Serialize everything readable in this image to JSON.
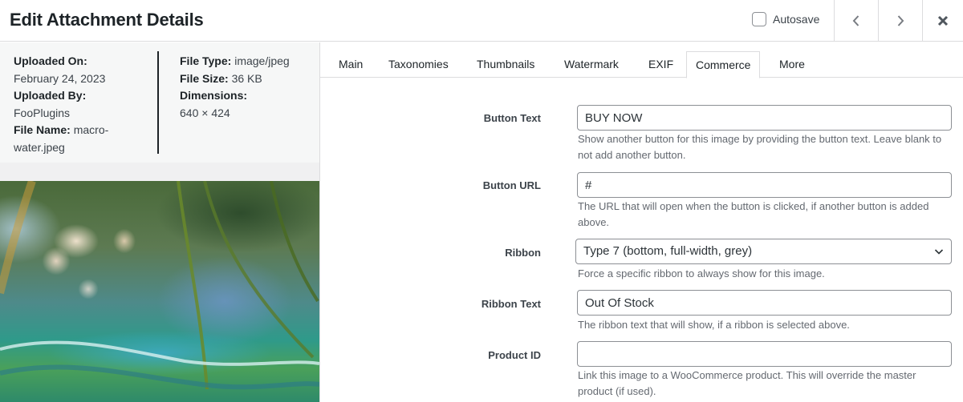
{
  "header": {
    "title": "Edit Attachment Details",
    "autosave_label": "Autosave",
    "autosave_checked": false,
    "icons": {
      "prev": "chevron-left-icon",
      "next": "chevron-right-icon",
      "close": "close-icon"
    }
  },
  "meta": {
    "uploaded_on_label": "Uploaded On:",
    "uploaded_on_value": "February 24, 2023",
    "uploaded_by_label": "Uploaded By:",
    "uploaded_by_value": "FooPlugins",
    "file_name_label": "File Name:",
    "file_name_value_1": "macro-",
    "file_name_value_2": "water.jpeg",
    "file_type_label": "File Type:",
    "file_type_value": "image/jpeg",
    "file_size_label": "File Size:",
    "file_size_value": "36 KB",
    "dimensions_label": "Dimensions:",
    "dimensions_value": "640 × 424"
  },
  "preview": {
    "alt": "macro water photo"
  },
  "tabs": [
    {
      "label": "Main",
      "active": false
    },
    {
      "label": "Taxonomies",
      "active": false
    },
    {
      "label": "Thumbnails",
      "active": false
    },
    {
      "label": "Watermark",
      "active": false
    },
    {
      "label": "EXIF",
      "active": false
    },
    {
      "label": "Commerce",
      "active": true
    },
    {
      "label": "More",
      "active": false
    }
  ],
  "commerce": {
    "button_text": {
      "label": "Button Text",
      "value": "BUY NOW",
      "help": "Show another button for this image by providing the button text. Leave blank to not add another button."
    },
    "button_url": {
      "label": "Button URL",
      "value": "#",
      "help": "The URL that will open when the button is clicked, if another button is added above."
    },
    "ribbon": {
      "label": "Ribbon",
      "selected": "Type 7 (bottom, full-width, grey)",
      "help": "Force a specific ribbon to always show for this image."
    },
    "ribbon_text": {
      "label": "Ribbon Text",
      "value": "Out Of Stock",
      "help": "The ribbon text that will show, if a ribbon is selected above."
    },
    "product_id": {
      "label": "Product ID",
      "value": "",
      "help": "Link this image to a WooCommerce product. This will override the master product (if used)."
    }
  }
}
